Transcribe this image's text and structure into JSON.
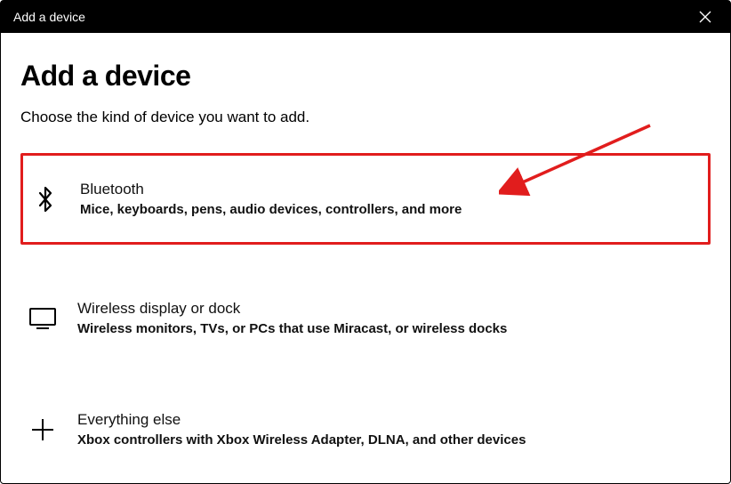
{
  "titlebar": {
    "title": "Add a device"
  },
  "page": {
    "title": "Add a device",
    "subtitle": "Choose the kind of device you want to add."
  },
  "options": [
    {
      "icon": "bluetooth-icon",
      "title": "Bluetooth",
      "description": "Mice, keyboards, pens, audio devices, controllers, and more",
      "highlighted": true
    },
    {
      "icon": "monitor-icon",
      "title": "Wireless display or dock",
      "description": "Wireless monitors, TVs, or PCs that use Miracast, or wireless docks",
      "highlighted": false
    },
    {
      "icon": "plus-icon",
      "title": "Everything else",
      "description": "Xbox controllers with Xbox Wireless Adapter, DLNA, and other devices",
      "highlighted": false
    }
  ],
  "annotation": {
    "arrow_color": "#e11d1d"
  }
}
